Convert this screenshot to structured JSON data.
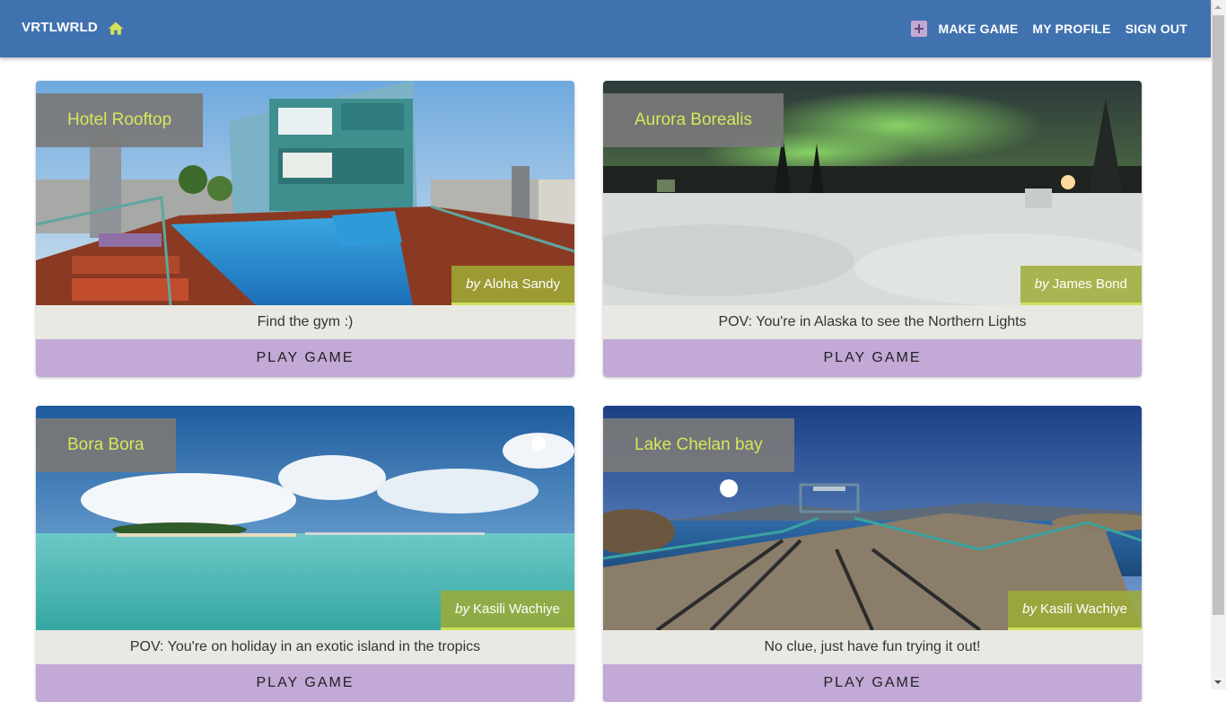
{
  "app": {
    "brand": "VRTLWRLD",
    "accent_color": "#d4e157",
    "appbar_color": "#4172b0"
  },
  "nav": {
    "make_game": "MAKE GAME",
    "my_profile": "MY PROFILE",
    "sign_out": "SIGN OUT"
  },
  "games": [
    {
      "title": "Hotel Rooftop",
      "by_label": "by",
      "author": "Aloha Sandy",
      "description": "Find the gym :)",
      "button": "PLAY GAME",
      "image": "rooftop-pool-panorama"
    },
    {
      "title": "Aurora Borealis",
      "by_label": "by",
      "author": "James Bond",
      "description": "POV: You're in Alaska to see the Northern Lights",
      "button": "PLAY GAME",
      "image": "aurora-snow-panorama"
    },
    {
      "title": "Bora Bora",
      "by_label": "by",
      "author": "Kasili Wachiye",
      "description": "POV: You're on holiday in an exotic island in the tropics",
      "button": "PLAY GAME",
      "image": "tropical-island-panorama"
    },
    {
      "title": "Lake Chelan bay",
      "by_label": "by",
      "author": "Kasili Wachiye",
      "description": "No clue, just have fun trying it out!",
      "button": "PLAY GAME",
      "image": "lake-dock-panorama"
    }
  ]
}
